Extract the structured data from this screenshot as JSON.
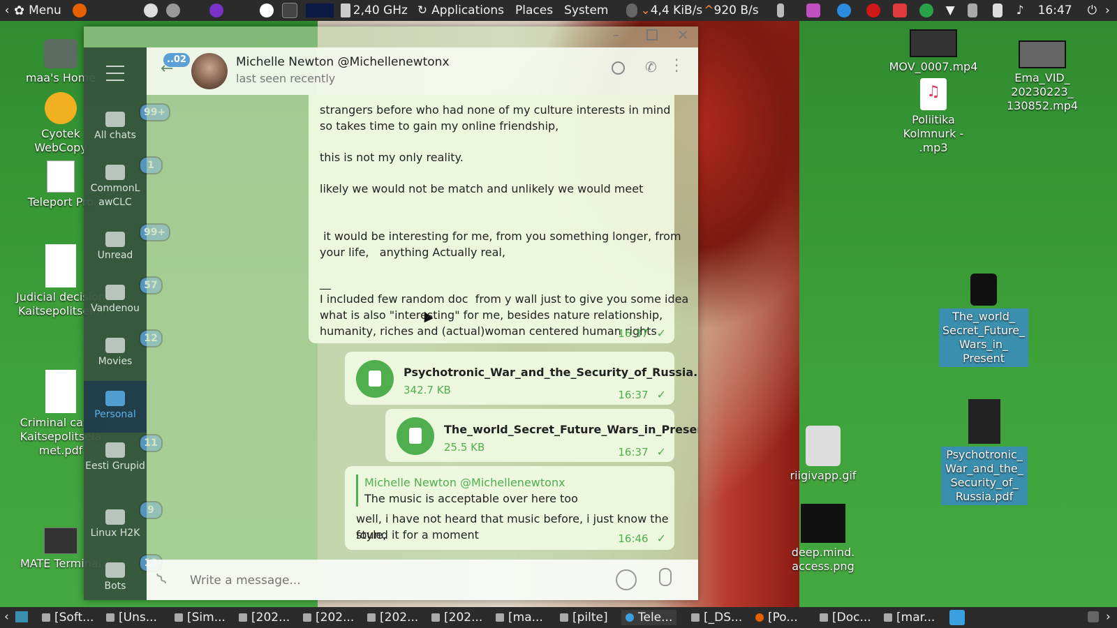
{
  "top_panel": {
    "menu_label": "Menu",
    "cpu_freq": "2,40 GHz",
    "menus": [
      "Applications",
      "Places",
      "System"
    ],
    "net_down": "4,4 KiB/s",
    "net_up": "920 B/s",
    "clock": "16:47"
  },
  "desktop_icons": [
    {
      "label": "maa's Home",
      "icon": "home-folder-icon"
    },
    {
      "label": "Cyotek WebCopy",
      "icon": "cyotek-icon"
    },
    {
      "label": "Teleport Pro",
      "icon": "teleport-icon"
    },
    {
      "label": "Judicial decision Kaitsepolitsei...",
      "icon": "document-icon"
    },
    {
      "label": "Criminal cases Kaitsepolitseia met.pdf",
      "icon": "document-icon"
    },
    {
      "label": "MATE Terminal",
      "icon": "terminal-icon"
    },
    {
      "label": "MOV_0007.mp4",
      "icon": "video-icon"
    },
    {
      "label": "Ema_VID_ 20230223_ 130852.mp4",
      "icon": "video-icon"
    },
    {
      "label": "Poliitika Kolmnurk - .mp3",
      "icon": "mp3-icon"
    },
    {
      "label": "The_world_ Secret_Future_ Wars_in_ Present",
      "icon": "file-icon"
    },
    {
      "label": "riigivapp.gif",
      "icon": "coat-of-arms-icon"
    },
    {
      "label": "Psychotronic_ War_and_the_ Security_of_ Russia.pdf",
      "icon": "pdf-icon"
    },
    {
      "label": "deep.mind. access.png",
      "icon": "image-icon"
    }
  ],
  "telegram": {
    "folders": [
      {
        "label": "All chats",
        "badge": "99+"
      },
      {
        "label": "CommonL awCLC",
        "badge": "1"
      },
      {
        "label": "Unread",
        "badge": "99+"
      },
      {
        "label": "Vandenou",
        "badge": "57"
      },
      {
        "label": "Movies",
        "badge": "12"
      },
      {
        "label": "Personal",
        "badge": ""
      },
      {
        "label": "Eesti Grupid",
        "badge": "11"
      },
      {
        "label": "Linux H2K",
        "badge": "9"
      },
      {
        "label": "Bots",
        "badge": "13"
      }
    ],
    "back_badge": "..02",
    "chat": {
      "name": "Michelle Newton @Michellenewtonx",
      "status": "last seen recently"
    },
    "messages": {
      "long_text_lines": [
        "strangers  before who had none of my culture interests in mind",
        "so takes time to gain my online friendship,",
        "this is not my only reality.",
        "likely we would not be  match and unlikely we would meet",
        " it would be interesting for me, from you something longer, from",
        "your life,   anything Actually real,",
        "__",
        "I included few random doc  from y wall just to give you some idea",
        "what is also \"interesting\" for me, besides nature relationship,",
        "humanity, riches and (actual)woman centered human rights"
      ],
      "long_text_time": "16:37",
      "file1": {
        "name": "Psychotronic_War_and_the_Security_of_Russia.pdf",
        "size": "342.7 KB",
        "time": "16:37"
      },
      "file2": {
        "name": "The_world_Secret_Future_Wars_in_Present",
        "size": "25.5 KB",
        "time": "16:37"
      },
      "reply": {
        "quoted_author": "Michelle Newton @Michellenewtonx",
        "quoted_text": "The music is acceptable over here too",
        "text_lines": [
          "well, i have not heard that music before, i just know the style,",
          "found it for a moment"
        ],
        "time": "16:46"
      }
    },
    "composer_placeholder": "Write a message..."
  },
  "taskbar": {
    "items": [
      "[Soft...",
      "[Uns...",
      "[Sim...",
      "[202...",
      "[202...",
      "[202...",
      "[202...",
      "[ma...",
      "[pilte]",
      "Tele...",
      "[_DS...",
      "[Po...",
      "[Doc...",
      "[mar..."
    ]
  },
  "colors": {
    "accent_green": "#4fae4e",
    "badge_blue": "#5a9fd6",
    "panel": "#2b2b2b"
  }
}
